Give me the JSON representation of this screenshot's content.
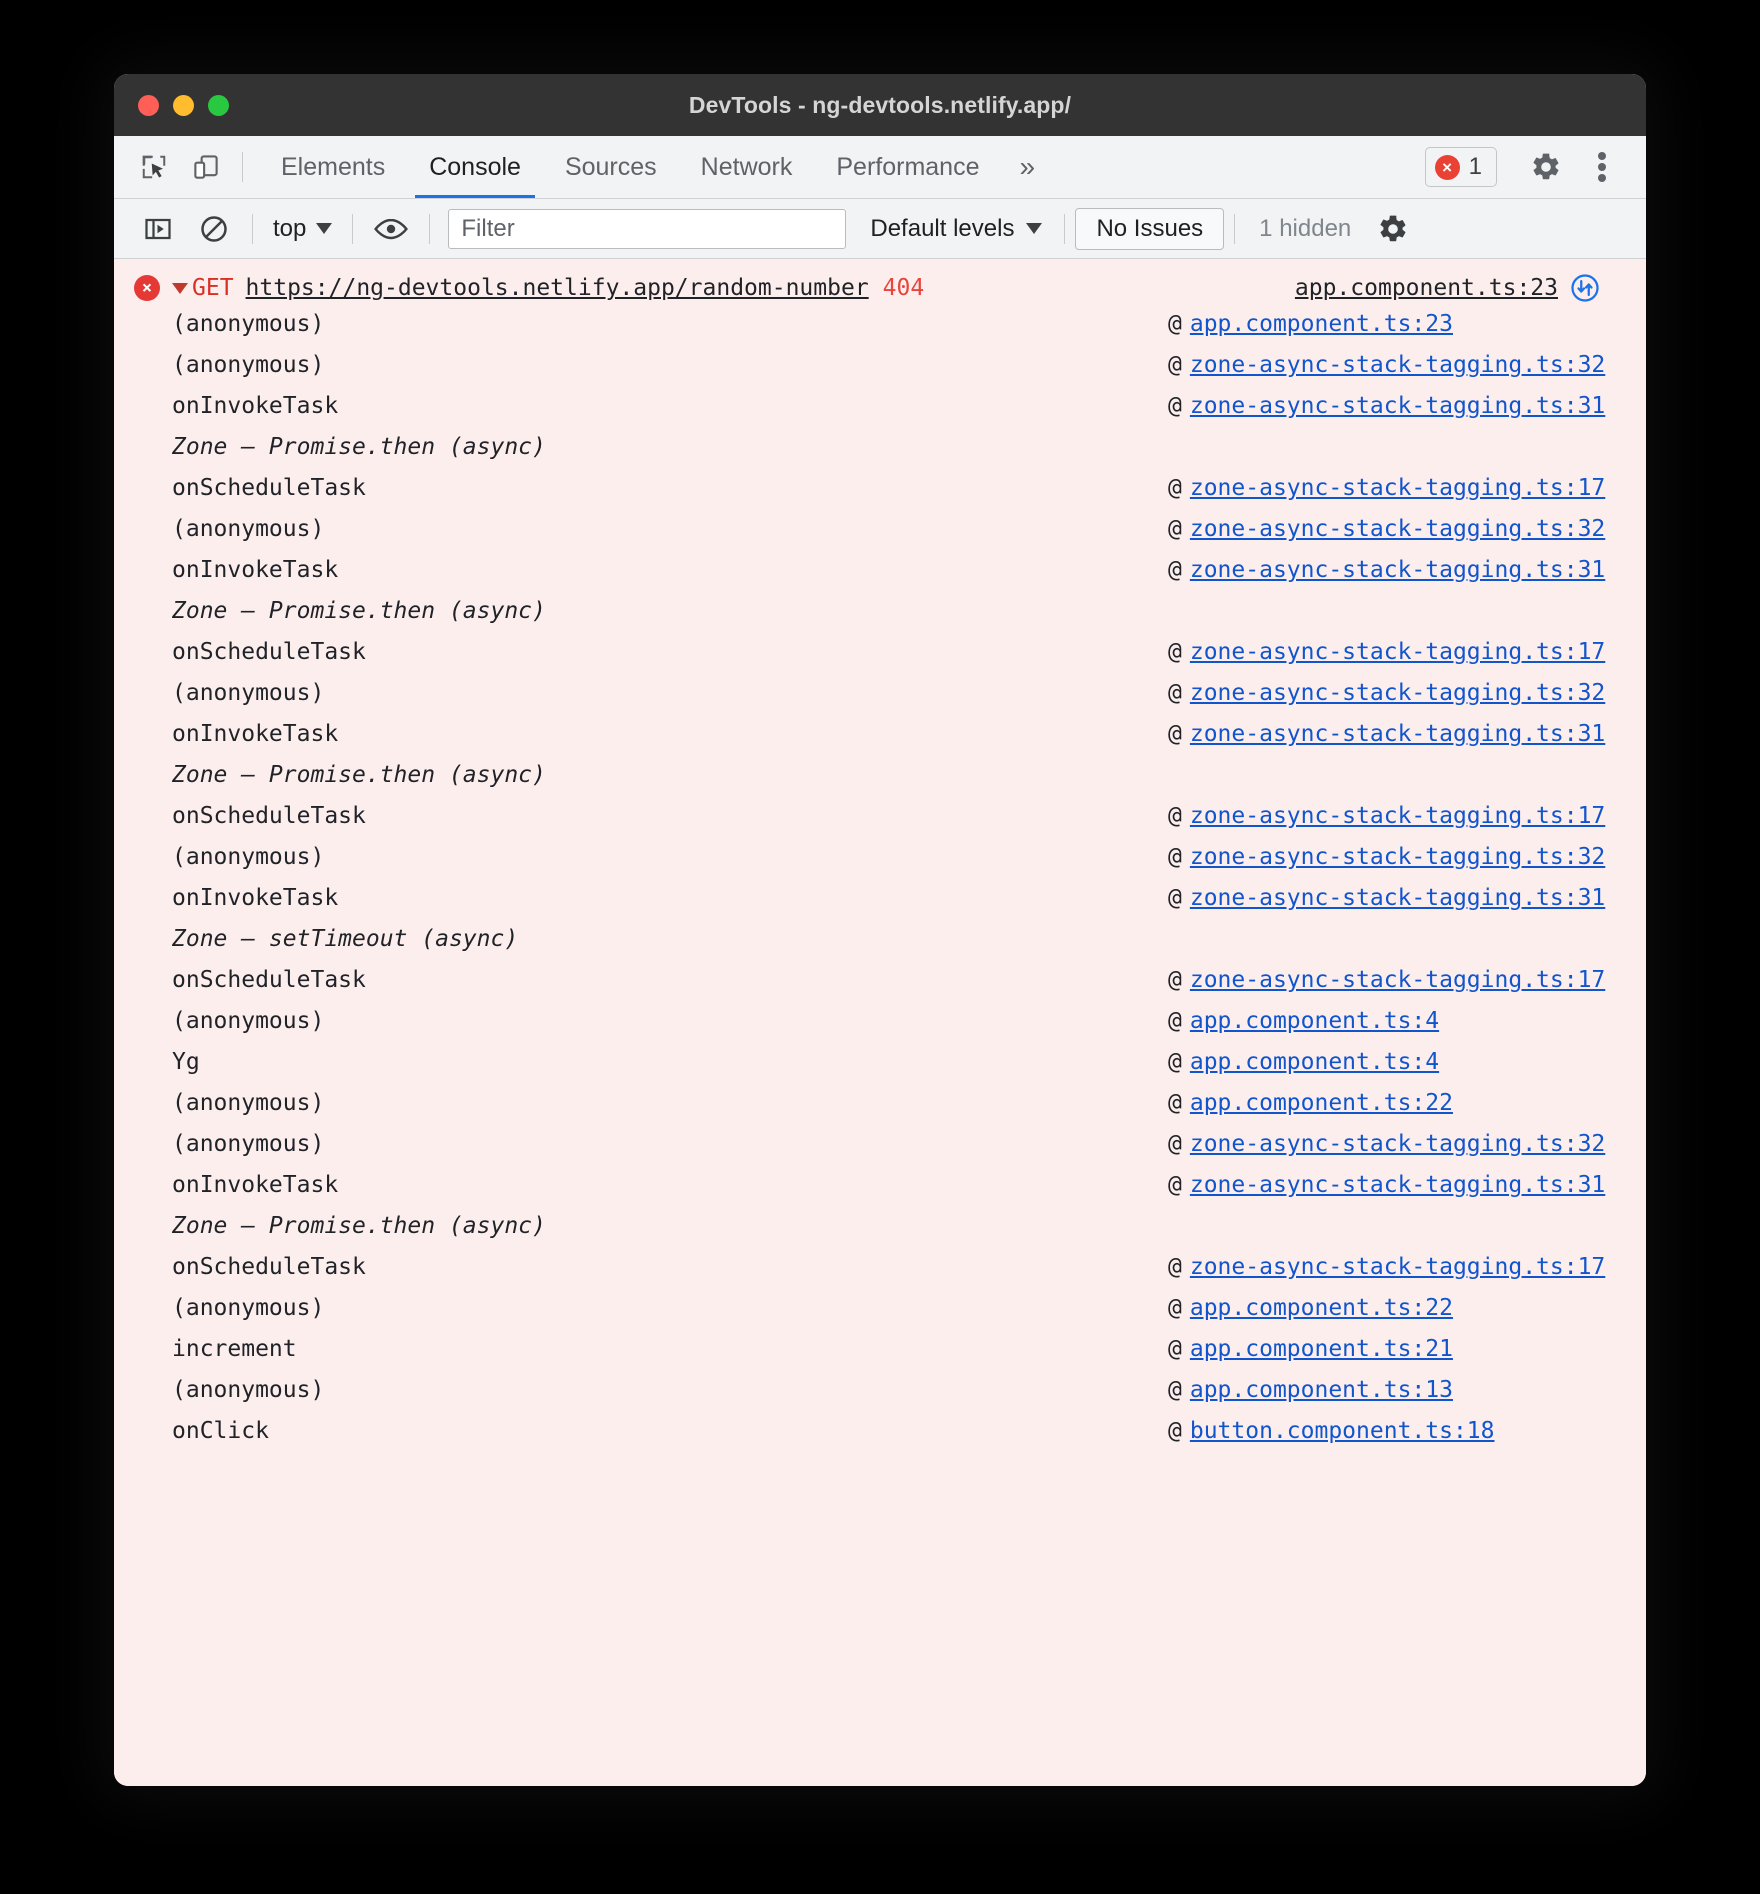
{
  "window": {
    "title": "DevTools - ng-devtools.netlify.app/"
  },
  "tabbar": {
    "inspect_icon": "inspect-element-icon",
    "device_icon": "device-toolbar-icon",
    "tabs": [
      {
        "label": "Elements",
        "active": false
      },
      {
        "label": "Console",
        "active": true
      },
      {
        "label": "Sources",
        "active": false
      },
      {
        "label": "Network",
        "active": false
      },
      {
        "label": "Performance",
        "active": false
      }
    ],
    "more_label": "»",
    "error_badge": {
      "icon": "×",
      "count": "1"
    },
    "settings_icon": "gear-icon",
    "more_options_icon": "kebab-menu-icon"
  },
  "console_toolbar": {
    "sidebar_toggle_icon": "console-sidebar-icon",
    "clear_icon": "clear-console-icon",
    "context": "top",
    "eye_icon": "live-expression-icon",
    "filter_placeholder": "Filter",
    "filter_value": "",
    "levels_label": "Default levels",
    "issues_label": "No Issues",
    "hidden_label": "1 hidden",
    "settings_icon": "gear-icon"
  },
  "colors": {
    "error_bg": "#fdeeee",
    "error_red": "#d93025",
    "link_blue": "#1155cc",
    "accent_blue": "#1a73e8",
    "titlebar": "#333333",
    "toolbar_bg": "#f1f3f4"
  },
  "console": {
    "header": {
      "level_icon": "×",
      "method": "GET",
      "url": "https://ng-devtools.netlify.app/random-number",
      "status": "404",
      "source": "app.component.ts:23",
      "request_icon": "network-request-icon"
    },
    "stack": [
      {
        "type": "frame",
        "fn": "(anonymous)",
        "src": "app.component.ts:23"
      },
      {
        "type": "frame",
        "fn": "(anonymous)",
        "src": "zone-async-stack-tagging.ts:32"
      },
      {
        "type": "frame",
        "fn": "onInvokeTask",
        "src": "zone-async-stack-tagging.ts:31"
      },
      {
        "type": "zone",
        "fn": "Zone — Promise.then (async)"
      },
      {
        "type": "frame",
        "fn": "onScheduleTask",
        "src": "zone-async-stack-tagging.ts:17"
      },
      {
        "type": "frame",
        "fn": "(anonymous)",
        "src": "zone-async-stack-tagging.ts:32"
      },
      {
        "type": "frame",
        "fn": "onInvokeTask",
        "src": "zone-async-stack-tagging.ts:31"
      },
      {
        "type": "zone",
        "fn": "Zone — Promise.then (async)"
      },
      {
        "type": "frame",
        "fn": "onScheduleTask",
        "src": "zone-async-stack-tagging.ts:17"
      },
      {
        "type": "frame",
        "fn": "(anonymous)",
        "src": "zone-async-stack-tagging.ts:32"
      },
      {
        "type": "frame",
        "fn": "onInvokeTask",
        "src": "zone-async-stack-tagging.ts:31"
      },
      {
        "type": "zone",
        "fn": "Zone — Promise.then (async)"
      },
      {
        "type": "frame",
        "fn": "onScheduleTask",
        "src": "zone-async-stack-tagging.ts:17"
      },
      {
        "type": "frame",
        "fn": "(anonymous)",
        "src": "zone-async-stack-tagging.ts:32"
      },
      {
        "type": "frame",
        "fn": "onInvokeTask",
        "src": "zone-async-stack-tagging.ts:31"
      },
      {
        "type": "zone",
        "fn": "Zone — setTimeout (async)"
      },
      {
        "type": "frame",
        "fn": "onScheduleTask",
        "src": "zone-async-stack-tagging.ts:17"
      },
      {
        "type": "frame",
        "fn": "(anonymous)",
        "src": "app.component.ts:4"
      },
      {
        "type": "frame",
        "fn": "Yg",
        "src": "app.component.ts:4"
      },
      {
        "type": "frame",
        "fn": "(anonymous)",
        "src": "app.component.ts:22"
      },
      {
        "type": "frame",
        "fn": "(anonymous)",
        "src": "zone-async-stack-tagging.ts:32"
      },
      {
        "type": "frame",
        "fn": "onInvokeTask",
        "src": "zone-async-stack-tagging.ts:31"
      },
      {
        "type": "zone",
        "fn": "Zone — Promise.then (async)"
      },
      {
        "type": "frame",
        "fn": "onScheduleTask",
        "src": "zone-async-stack-tagging.ts:17"
      },
      {
        "type": "frame",
        "fn": "(anonymous)",
        "src": "app.component.ts:22"
      },
      {
        "type": "frame",
        "fn": "increment",
        "src": "app.component.ts:21"
      },
      {
        "type": "frame",
        "fn": "(anonymous)",
        "src": "app.component.ts:13"
      },
      {
        "type": "frame",
        "fn": "onClick",
        "src": "button.component.ts:18"
      }
    ]
  }
}
